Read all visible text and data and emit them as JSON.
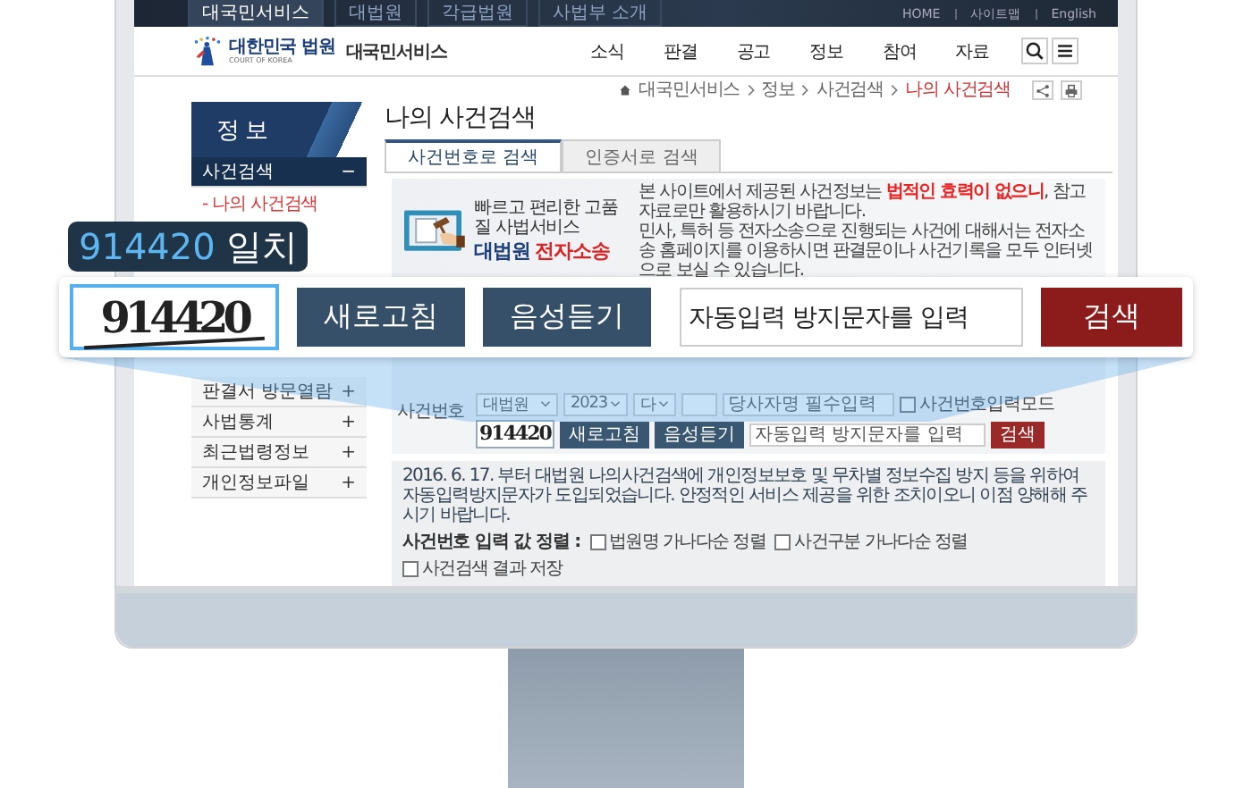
{
  "top_bar": {
    "tabs": [
      {
        "label": "대국민서비스",
        "selected": true
      },
      {
        "label": "대법원",
        "selected": false
      },
      {
        "label": "각급법원",
        "selected": false
      },
      {
        "label": "사법부 소개",
        "selected": false
      }
    ],
    "links": [
      "HOME",
      "사이트맵",
      "English"
    ]
  },
  "header": {
    "logo_title": "대한민국 법원",
    "logo_subtitle": "COURT OF KOREA",
    "service_name": "대국민서비스",
    "nav": [
      "소식",
      "판결",
      "공고",
      "정보",
      "참여",
      "자료"
    ]
  },
  "breadcrumb": [
    "대국민서비스",
    "정보",
    "사건검색",
    "나의 사건검색"
  ],
  "sidebar": {
    "title": "정보",
    "items": [
      {
        "label": "사건검색",
        "toggle": "−",
        "expanded": true,
        "children": [
          {
            "label": "- 나의 사건검색",
            "selected": true
          }
        ]
      },
      {
        "label": "판결서 방문열람",
        "toggle": "+",
        "expanded": false
      },
      {
        "label": "사법통계",
        "toggle": "+",
        "expanded": false
      },
      {
        "label": "최근법령정보",
        "toggle": "+",
        "expanded": false
      },
      {
        "label": "개인정보파일",
        "toggle": "+",
        "expanded": false
      }
    ]
  },
  "page_title": "나의 사건검색",
  "tabs": [
    {
      "label": "사건번호로 검색",
      "selected": true
    },
    {
      "label": "인증서로 검색",
      "selected": false
    }
  ],
  "banner": {
    "tagline": "빠르고 편리한 고품질 사법서비스",
    "title_prefix": "대법원",
    "title_highlight": "전자소송",
    "notices": [
      "본 사이트에서 제공된 사건정보는 **법적인 효력이 없으니**, 참고자료로만 활용하시기 바랍니다.",
      "민사, 특허 등 전자소송으로 진행되는 사건에 대해서는 전자소송 홈페이지를 이용하시면 판결문이나 사건기록을 모두 인터넷으로 보실 수 있습니다."
    ]
  },
  "search_form": {
    "label": "사건번호",
    "court": "대법원",
    "year": "2023",
    "case_type": "다",
    "party_placeholder": "당사자명 필수입력",
    "mode_option": {
      "label": "사건번호입력모드",
      "checked": false
    },
    "captcha": {
      "text": "914420",
      "refresh_button": "새로고침",
      "audio_button": "음성듣기",
      "input_placeholder": "자동입력 방지문자를 입력",
      "search_button": "검색"
    }
  },
  "notice": {
    "text": "2016. 6. 17. 부터 대법원 나의사건검색에 개인정보보호 및 무차별 정보수집 방지 등을 위하여 자동입력방지문자가 도입되었습니다. 안정적인 서비스 제공을 위한 조치이오니 이점 양해해 주시기 바랍니다.",
    "options_label": "사건번호 입력 값 정렬 :",
    "options": [
      {
        "label": "법원명 가나다순 정렬",
        "checked": false
      },
      {
        "label": "사건구분 가나다순 정렬",
        "checked": false
      },
      {
        "label": "사건검색 결과 저장",
        "checked": false
      }
    ]
  },
  "callout": {
    "match_code": "914420",
    "match_label": "일치",
    "captcha_text": "914420",
    "refresh_button": "새로고침",
    "audio_button": "음성듣기",
    "input_placeholder": "자동입력 방지문자를 입력",
    "search_button": "검색"
  }
}
